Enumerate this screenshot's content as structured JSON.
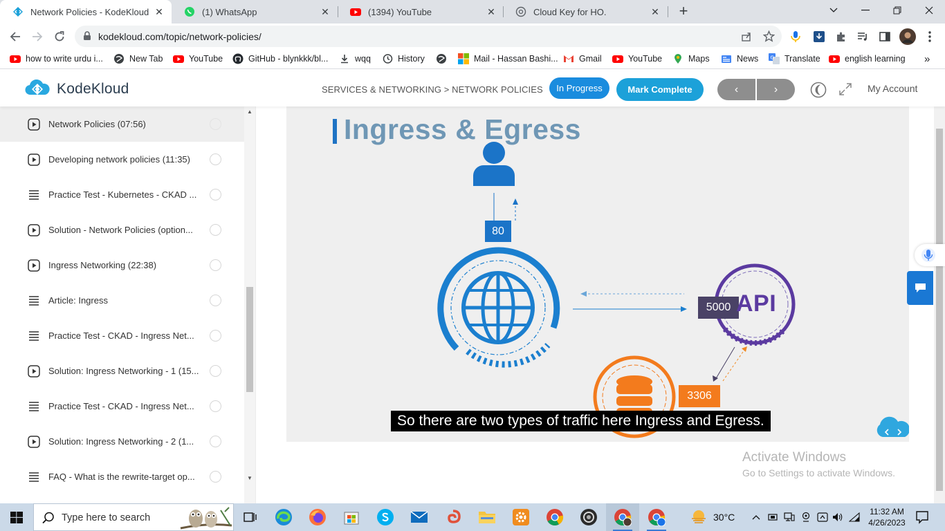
{
  "browser": {
    "tabs": [
      {
        "title": "Network Policies - KodeKloud",
        "favicon": "kodekloud-icon"
      },
      {
        "title": "(1) WhatsApp",
        "favicon": "whatsapp-icon"
      },
      {
        "title": "(1394) YouTube",
        "favicon": "youtube-icon"
      },
      {
        "title": "Cloud Key for HO.",
        "favicon": "openai-icon"
      }
    ],
    "new_tab_label": "+",
    "url": "kodekloud.com/topic/network-policies/",
    "bookmarks": [
      {
        "label": "how to write urdu i...",
        "icon": "youtube-icon"
      },
      {
        "label": "New Tab",
        "icon": "globe-icon"
      },
      {
        "label": "YouTube",
        "icon": "youtube-icon"
      },
      {
        "label": "GitHub - blynkkk/bl...",
        "icon": "github-icon"
      },
      {
        "label": "wqq",
        "icon": "download-icon"
      },
      {
        "label": "History",
        "icon": "history-icon"
      },
      {
        "label": "",
        "icon": "globe-icon"
      },
      {
        "label": "Mail - Hassan Bashi...",
        "icon": "microsoft-icon"
      },
      {
        "label": "Gmail",
        "icon": "gmail-icon"
      },
      {
        "label": "YouTube",
        "icon": "youtube-icon"
      },
      {
        "label": "Maps",
        "icon": "maps-icon"
      },
      {
        "label": "News",
        "icon": "news-icon"
      },
      {
        "label": "Translate",
        "icon": "translate-icon"
      },
      {
        "label": "english learning",
        "icon": "youtube-icon"
      }
    ],
    "more_bookmarks": "»"
  },
  "site": {
    "logo_text": "KodeKloud",
    "breadcrumb": "SERVICES & NETWORKING > NETWORK POLICIES",
    "status_button": "In Progress",
    "complete_button": "Mark Complete",
    "prev_label": "‹",
    "next_label": "›",
    "account_label": "My Account",
    "accent": "#1a8cde"
  },
  "sidebar": {
    "lessons": [
      {
        "title": "Network Policies (07:56)",
        "type": "video",
        "current": true
      },
      {
        "title": "Developing network policies (11:35)",
        "type": "video"
      },
      {
        "title": "Practice Test - Kubernetes - CKAD ...",
        "type": "lab"
      },
      {
        "title": "Solution - Network Policies (option...",
        "type": "video"
      },
      {
        "title": "Ingress Networking (22:38)",
        "type": "video"
      },
      {
        "title": "Article: Ingress",
        "type": "lab"
      },
      {
        "title": "Practice Test - CKAD - Ingress Net...",
        "type": "lab"
      },
      {
        "title": "Solution: Ingress Networking - 1 (15...",
        "type": "video"
      },
      {
        "title": "Practice Test - CKAD - Ingress Net...",
        "type": "lab"
      },
      {
        "title": "Solution: Ingress Networking - 2 (1...",
        "type": "video"
      },
      {
        "title": "FAQ - What is the rewrite-target op...",
        "type": "lab"
      }
    ]
  },
  "video": {
    "slide_title": "Ingress & Egress",
    "port_user": "80",
    "port_api": "5000",
    "api_label": "API",
    "port_db": "3306",
    "caption": "So there are two types of traffic here Ingress and Egress."
  },
  "watermark": {
    "line1": "Activate Windows",
    "line2": "Go to Settings to activate Windows."
  },
  "taskbar": {
    "search_placeholder": "Type here to search",
    "temperature": "30°C",
    "time": "11:32 AM",
    "date": "4/26/2023"
  }
}
